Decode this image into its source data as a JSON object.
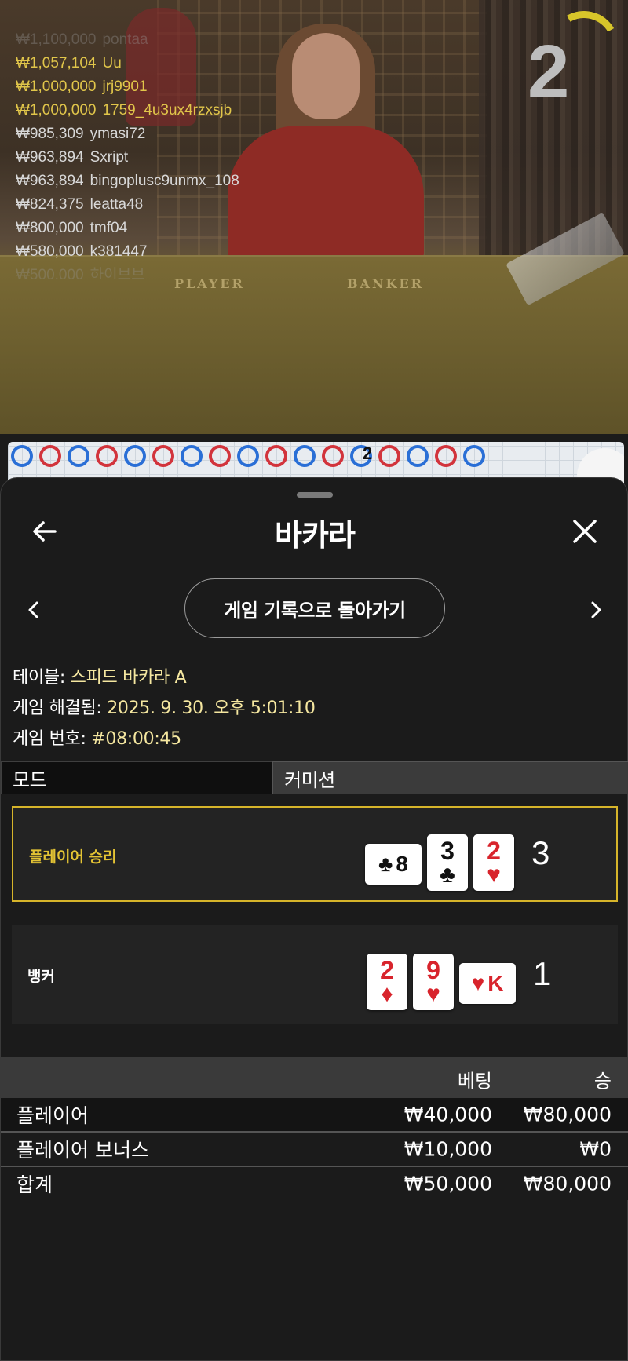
{
  "video": {
    "countdown": "2",
    "table_labels": {
      "player": "PLAYER",
      "banker": "BANKER"
    },
    "chat": [
      {
        "amount": "₩1,100,000",
        "user": "pontaa",
        "color": "#9a9a9a",
        "opacity": 0.35
      },
      {
        "amount": "₩1,057,104",
        "user": "Uu",
        "color": "#e1c64a",
        "opacity": 1
      },
      {
        "amount": "₩1,000,000",
        "user": "jrj9901",
        "color": "#e1c64a",
        "opacity": 1
      },
      {
        "amount": "₩1,000,000",
        "user": "1759_4u3ux4rzxsjb",
        "color": "#e1c64a",
        "opacity": 1
      },
      {
        "amount": "₩985,309",
        "user": "ymasi72",
        "color": "#d8d8d8",
        "opacity": 1
      },
      {
        "amount": "₩963,894",
        "user": "Sxript",
        "color": "#d8d8d8",
        "opacity": 1
      },
      {
        "amount": "₩963,894",
        "user": "bingoplusc9unmx_108",
        "color": "#d8d8d8",
        "opacity": 1
      },
      {
        "amount": "₩824,375",
        "user": "leatta48",
        "color": "#d8d8d8",
        "opacity": 1
      },
      {
        "amount": "₩800,000",
        "user": "tmf04",
        "color": "#d8d8d8",
        "opacity": 1
      },
      {
        "amount": "₩580,000",
        "user": "k381447",
        "color": "#d8d8d8",
        "opacity": 1
      },
      {
        "amount": "₩500,000",
        "user": "하이브브",
        "color": "#9a9a9a",
        "opacity": 0.3
      }
    ]
  },
  "road": {
    "dots": [
      "blue",
      "red",
      "blue",
      "red",
      "blue",
      "red",
      "blue",
      "red",
      "blue",
      "red",
      "blue",
      "red",
      "blue",
      "red",
      "blue",
      "red",
      "blue"
    ],
    "badge": "2"
  },
  "sheet": {
    "title": "바카라",
    "back_to_history": "게임 기록으로 돌아가기",
    "info": {
      "table_label": "테이블:",
      "table_value": "스피드 바카라 A",
      "resolved_label": "게임 해결됨:",
      "resolved_value": "2025. 9. 30. 오후 5:01:10",
      "number_label": "게임 번호:",
      "number_value": "#08:00:45"
    },
    "tabs": [
      {
        "label": "모드",
        "active": true
      },
      {
        "label": "커미션",
        "active": false
      }
    ],
    "player": {
      "label": "플레이어 승리",
      "score": "3",
      "cards": [
        {
          "rank": "8",
          "suit": "♣",
          "color": "black",
          "sideways": true
        },
        {
          "rank": "3",
          "suit": "♣",
          "color": "black",
          "sideways": false
        },
        {
          "rank": "2",
          "suit": "♥",
          "color": "red",
          "sideways": false
        }
      ]
    },
    "banker": {
      "label": "뱅커",
      "score": "1",
      "cards": [
        {
          "rank": "2",
          "suit": "♦",
          "color": "red",
          "sideways": false
        },
        {
          "rank": "9",
          "suit": "♥",
          "color": "red",
          "sideways": false
        },
        {
          "rank": "K",
          "suit": "♥",
          "color": "red",
          "sideways": true
        }
      ]
    },
    "bets": {
      "headers": {
        "bet": "베팅",
        "win": "승"
      },
      "rows": [
        {
          "name": "플레이어",
          "bet": "₩40,000",
          "win": "₩80,000"
        },
        {
          "name": "플레이어 보너스",
          "bet": "₩10,000",
          "win": "₩0"
        }
      ],
      "total": {
        "name": "합계",
        "bet": "₩50,000",
        "win": "₩80,000"
      }
    },
    "colors": {
      "accent_gold": "#d6b42a",
      "player_blue": "#2a6fd6",
      "banker_red": "#d2343c",
      "info_value": "#f5e7a0"
    }
  }
}
